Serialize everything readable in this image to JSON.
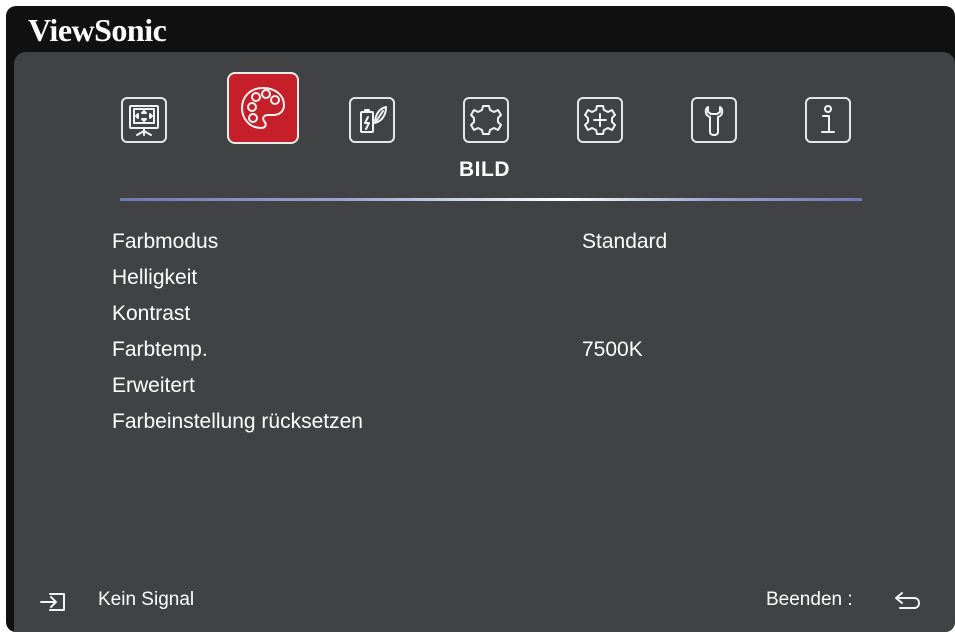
{
  "brand": {
    "name": "ViewSonic"
  },
  "tabs": [
    {
      "id": "display",
      "icon": "screen-icon",
      "active": false
    },
    {
      "id": "picture",
      "icon": "palette-icon",
      "active": true
    },
    {
      "id": "power-management",
      "icon": "battery-leaf-icon",
      "active": false
    },
    {
      "id": "basic",
      "icon": "gear-icon",
      "active": false
    },
    {
      "id": "advanced",
      "icon": "gear-plus-icon",
      "active": false
    },
    {
      "id": "service",
      "icon": "wrench-icon",
      "active": false
    },
    {
      "id": "information",
      "icon": "info-icon",
      "active": false
    }
  ],
  "section": {
    "title": "BILD"
  },
  "menu": [
    {
      "label": "Farbmodus",
      "value": "Standard"
    },
    {
      "label": "Helligkeit",
      "value": ""
    },
    {
      "label": "Kontrast",
      "value": ""
    },
    {
      "label": "Farbtemp.",
      "value": "7500K"
    },
    {
      "label": "Erweitert",
      "value": ""
    },
    {
      "label": "Farbeinstellung rücksetzen",
      "value": ""
    }
  ],
  "footer": {
    "input_status": "Kein Signal",
    "exit_label": "Beenden :"
  },
  "colors": {
    "panel": "#404244",
    "frame": "#111111",
    "active_tab": "#c51f2a",
    "text": "#ffffff"
  }
}
